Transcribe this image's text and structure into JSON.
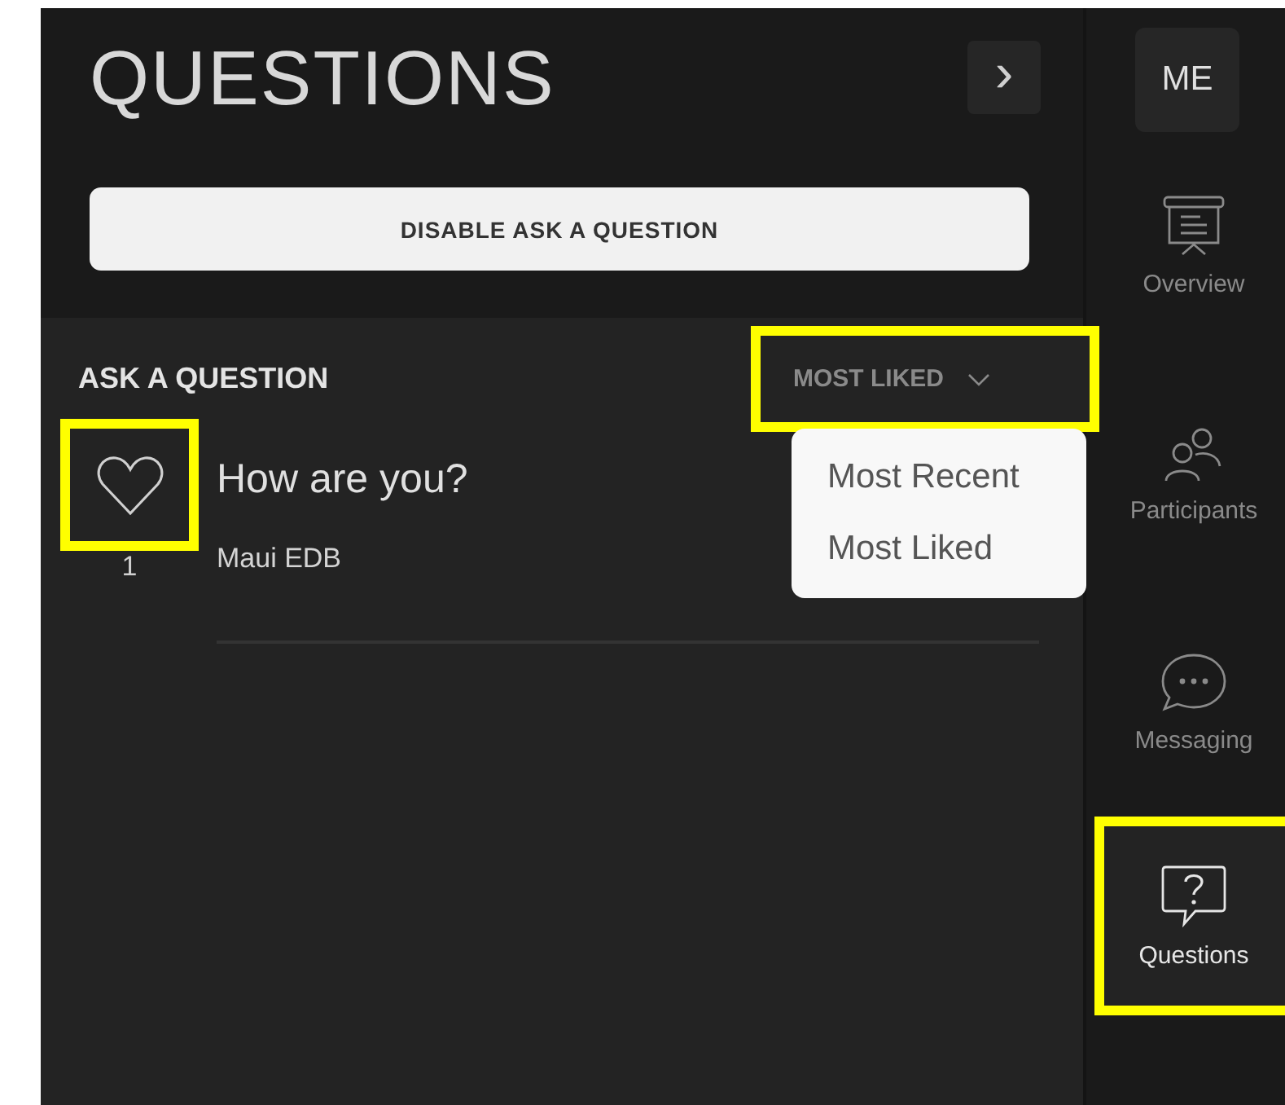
{
  "panel": {
    "title": "QUESTIONS",
    "collapse_icon": "›",
    "disable_button": "DISABLE ASK A QUESTION"
  },
  "section": {
    "heading": "ASK A QUESTION",
    "sort": {
      "label": "MOST LIKED",
      "expanded": true,
      "highlighted": true,
      "options": [
        "Most Recent",
        "Most Liked"
      ]
    }
  },
  "questions": [
    {
      "text": "How are you?",
      "author": "Maui EDB",
      "likes": "1",
      "liked": false,
      "highlighted": true
    }
  ],
  "nav": {
    "avatar": "ME",
    "items": [
      {
        "kind": "overview",
        "label": "Overview",
        "selected": false,
        "highlighted": false
      },
      {
        "kind": "participants",
        "label": "Participants",
        "selected": false,
        "highlighted": false
      },
      {
        "kind": "messaging",
        "label": "Messaging",
        "selected": false,
        "highlighted": false
      },
      {
        "kind": "questions",
        "label": "Questions",
        "selected": true,
        "highlighted": true
      }
    ]
  }
}
